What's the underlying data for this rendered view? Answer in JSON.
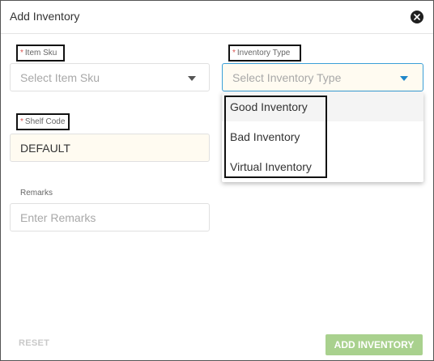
{
  "dialog": {
    "title": "Add Inventory"
  },
  "form": {
    "item_sku": {
      "required_mark": "*",
      "label": "Item Sku",
      "placeholder": "Select Item Sku"
    },
    "inventory_type": {
      "required_mark": "*",
      "label": "Inventory Type",
      "placeholder": "Select Inventory Type",
      "options": [
        "Good Inventory",
        "Bad Inventory",
        "Virtual Inventory"
      ]
    },
    "shelf_code": {
      "required_mark": "*",
      "label": "Shelf Code",
      "value": "DEFAULT"
    },
    "remarks": {
      "label": "Remarks",
      "placeholder": "Enter Remarks"
    }
  },
  "footer": {
    "reset_label": "RESET",
    "add_label": "ADD INVENTORY"
  },
  "colors": {
    "accent_blue": "#1f86c9",
    "add_button_bg": "#a9d18e",
    "required_red": "#d9534f",
    "field_cream": "#fffbf1"
  },
  "icons": {
    "close": "close-icon",
    "dropdown": "caret-down-icon"
  }
}
